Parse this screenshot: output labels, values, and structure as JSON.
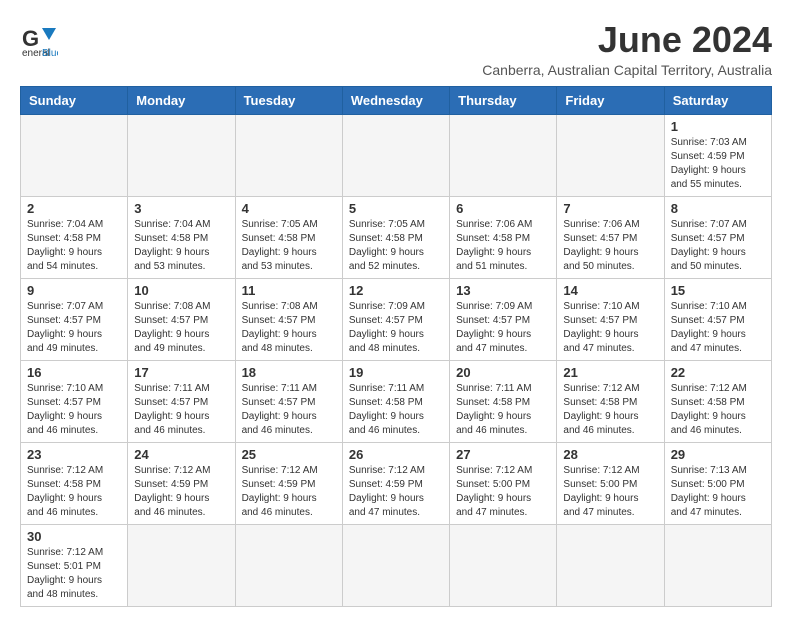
{
  "header": {
    "logo_general": "General",
    "logo_blue": "Blue",
    "main_title": "June 2024",
    "sub_title": "Canberra, Australian Capital Territory, Australia"
  },
  "weekdays": [
    "Sunday",
    "Monday",
    "Tuesday",
    "Wednesday",
    "Thursday",
    "Friday",
    "Saturday"
  ],
  "days": [
    {
      "date": "",
      "info": ""
    },
    {
      "date": "",
      "info": ""
    },
    {
      "date": "",
      "info": ""
    },
    {
      "date": "",
      "info": ""
    },
    {
      "date": "",
      "info": ""
    },
    {
      "date": "",
      "info": ""
    },
    {
      "date": "1",
      "info": "Sunrise: 7:03 AM\nSunset: 4:59 PM\nDaylight: 9 hours\nand 55 minutes."
    },
    {
      "date": "2",
      "info": "Sunrise: 7:04 AM\nSunset: 4:58 PM\nDaylight: 9 hours\nand 54 minutes."
    },
    {
      "date": "3",
      "info": "Sunrise: 7:04 AM\nSunset: 4:58 PM\nDaylight: 9 hours\nand 53 minutes."
    },
    {
      "date": "4",
      "info": "Sunrise: 7:05 AM\nSunset: 4:58 PM\nDaylight: 9 hours\nand 53 minutes."
    },
    {
      "date": "5",
      "info": "Sunrise: 7:05 AM\nSunset: 4:58 PM\nDaylight: 9 hours\nand 52 minutes."
    },
    {
      "date": "6",
      "info": "Sunrise: 7:06 AM\nSunset: 4:58 PM\nDaylight: 9 hours\nand 51 minutes."
    },
    {
      "date": "7",
      "info": "Sunrise: 7:06 AM\nSunset: 4:57 PM\nDaylight: 9 hours\nand 50 minutes."
    },
    {
      "date": "8",
      "info": "Sunrise: 7:07 AM\nSunset: 4:57 PM\nDaylight: 9 hours\nand 50 minutes."
    },
    {
      "date": "9",
      "info": "Sunrise: 7:07 AM\nSunset: 4:57 PM\nDaylight: 9 hours\nand 49 minutes."
    },
    {
      "date": "10",
      "info": "Sunrise: 7:08 AM\nSunset: 4:57 PM\nDaylight: 9 hours\nand 49 minutes."
    },
    {
      "date": "11",
      "info": "Sunrise: 7:08 AM\nSunset: 4:57 PM\nDaylight: 9 hours\nand 48 minutes."
    },
    {
      "date": "12",
      "info": "Sunrise: 7:09 AM\nSunset: 4:57 PM\nDaylight: 9 hours\nand 48 minutes."
    },
    {
      "date": "13",
      "info": "Sunrise: 7:09 AM\nSunset: 4:57 PM\nDaylight: 9 hours\nand 47 minutes."
    },
    {
      "date": "14",
      "info": "Sunrise: 7:10 AM\nSunset: 4:57 PM\nDaylight: 9 hours\nand 47 minutes."
    },
    {
      "date": "15",
      "info": "Sunrise: 7:10 AM\nSunset: 4:57 PM\nDaylight: 9 hours\nand 47 minutes."
    },
    {
      "date": "16",
      "info": "Sunrise: 7:10 AM\nSunset: 4:57 PM\nDaylight: 9 hours\nand 46 minutes."
    },
    {
      "date": "17",
      "info": "Sunrise: 7:11 AM\nSunset: 4:57 PM\nDaylight: 9 hours\nand 46 minutes."
    },
    {
      "date": "18",
      "info": "Sunrise: 7:11 AM\nSunset: 4:57 PM\nDaylight: 9 hours\nand 46 minutes."
    },
    {
      "date": "19",
      "info": "Sunrise: 7:11 AM\nSunset: 4:58 PM\nDaylight: 9 hours\nand 46 minutes."
    },
    {
      "date": "20",
      "info": "Sunrise: 7:11 AM\nSunset: 4:58 PM\nDaylight: 9 hours\nand 46 minutes."
    },
    {
      "date": "21",
      "info": "Sunrise: 7:12 AM\nSunset: 4:58 PM\nDaylight: 9 hours\nand 46 minutes."
    },
    {
      "date": "22",
      "info": "Sunrise: 7:12 AM\nSunset: 4:58 PM\nDaylight: 9 hours\nand 46 minutes."
    },
    {
      "date": "23",
      "info": "Sunrise: 7:12 AM\nSunset: 4:58 PM\nDaylight: 9 hours\nand 46 minutes."
    },
    {
      "date": "24",
      "info": "Sunrise: 7:12 AM\nSunset: 4:59 PM\nDaylight: 9 hours\nand 46 minutes."
    },
    {
      "date": "25",
      "info": "Sunrise: 7:12 AM\nSunset: 4:59 PM\nDaylight: 9 hours\nand 46 minutes."
    },
    {
      "date": "26",
      "info": "Sunrise: 7:12 AM\nSunset: 4:59 PM\nDaylight: 9 hours\nand 47 minutes."
    },
    {
      "date": "27",
      "info": "Sunrise: 7:12 AM\nSunset: 5:00 PM\nDaylight: 9 hours\nand 47 minutes."
    },
    {
      "date": "28",
      "info": "Sunrise: 7:12 AM\nSunset: 5:00 PM\nDaylight: 9 hours\nand 47 minutes."
    },
    {
      "date": "29",
      "info": "Sunrise: 7:13 AM\nSunset: 5:00 PM\nDaylight: 9 hours\nand 47 minutes."
    },
    {
      "date": "30",
      "info": "Sunrise: 7:12 AM\nSunset: 5:01 PM\nDaylight: 9 hours\nand 48 minutes."
    },
    {
      "date": "",
      "info": ""
    },
    {
      "date": "",
      "info": ""
    },
    {
      "date": "",
      "info": ""
    },
    {
      "date": "",
      "info": ""
    },
    {
      "date": "",
      "info": ""
    },
    {
      "date": "",
      "info": ""
    }
  ]
}
